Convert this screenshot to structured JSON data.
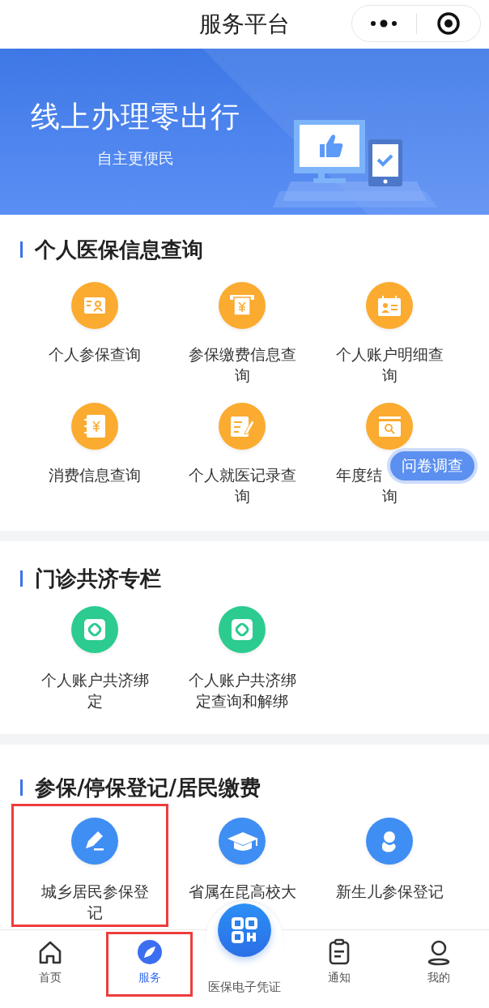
{
  "header": {
    "title": "服务平台"
  },
  "banner": {
    "title": "线上办理零出行",
    "subtitle": "自主更便民"
  },
  "sections": [
    {
      "title": "个人医保信息查询",
      "color": "#fbab2f",
      "items": [
        {
          "label_lines": [
            "个人参保查询"
          ],
          "highlighted": false
        },
        {
          "label_lines": [
            "参保缴费信息查",
            "询"
          ],
          "highlighted": false
        },
        {
          "label_lines": [
            "个人账户明细查",
            "询"
          ],
          "highlighted": false
        },
        {
          "label_lines": [
            "消费信息查询"
          ],
          "highlighted": false
        },
        {
          "label_lines": [
            "个人就医记录查",
            "询"
          ],
          "highlighted": false
        },
        {
          "label_lines": [
            "年度结",
            "询"
          ],
          "highlighted": false
        }
      ]
    },
    {
      "title": "门诊共济专栏",
      "color": "#2ccb8f",
      "items": [
        {
          "label_lines": [
            "个人账户共济绑",
            "定"
          ],
          "highlighted": false
        },
        {
          "label_lines": [
            "个人账户共济绑",
            "定查询和解绑"
          ],
          "highlighted": false
        }
      ]
    },
    {
      "title": "参保/停保登记/居民缴费",
      "color": "#3f8ef3",
      "items": [
        {
          "label_lines": [
            "城乡居民参保登",
            "记"
          ],
          "highlighted": true
        },
        {
          "label_lines": [
            "省属在昆高校大"
          ],
          "highlighted": false
        },
        {
          "label_lines": [
            "新生儿参保登记"
          ],
          "highlighted": false
        }
      ]
    }
  ],
  "survey_button": {
    "label": "问卷调查"
  },
  "tab_bar": [
    {
      "kind": "tab",
      "label": "首页",
      "selected": false,
      "highlighted": false
    },
    {
      "kind": "tab",
      "label": "服务",
      "selected": true,
      "highlighted": true
    },
    {
      "kind": "scan",
      "label": "医保电子凭证",
      "selected": false,
      "highlighted": false
    },
    {
      "kind": "tab",
      "label": "通知",
      "selected": false,
      "highlighted": false
    },
    {
      "kind": "tab",
      "label": "我的",
      "selected": false,
      "highlighted": false
    }
  ]
}
